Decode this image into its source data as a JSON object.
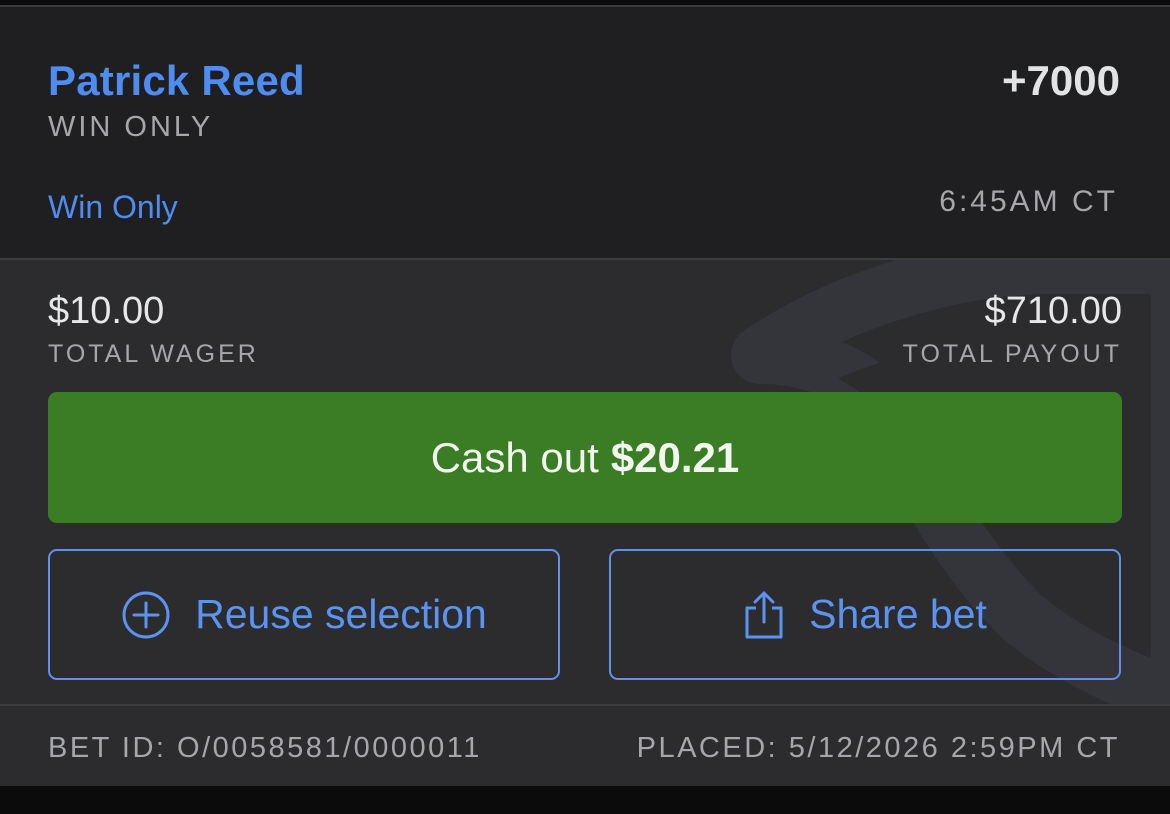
{
  "bet": {
    "selection": "Patrick Reed",
    "market_type": "WIN ONLY",
    "odds": "+7000",
    "sub_market": "Win Only",
    "event_time": "6:45AM CT"
  },
  "totals": {
    "wager_value": "$10.00",
    "wager_label": "TOTAL WAGER",
    "payout_value": "$710.00",
    "payout_label": "TOTAL PAYOUT"
  },
  "actions": {
    "cashout_prefix": "Cash out",
    "cashout_amount": "$20.21",
    "reuse_label": "Reuse selection",
    "share_label": "Share bet"
  },
  "footer": {
    "bet_id": "BET ID: O/0058581/0000011",
    "placed": "PLACED: 5/12/2026 2:59PM CT"
  },
  "icons": {
    "reuse": "plus-circle-icon",
    "share": "share-icon",
    "watermark": "shield-logo"
  },
  "colors": {
    "accent_blue": "#4e8cf0",
    "cashout_green": "#3a7d25",
    "panel_dark": "#1f1f21",
    "panel": "#2c2c2f"
  }
}
